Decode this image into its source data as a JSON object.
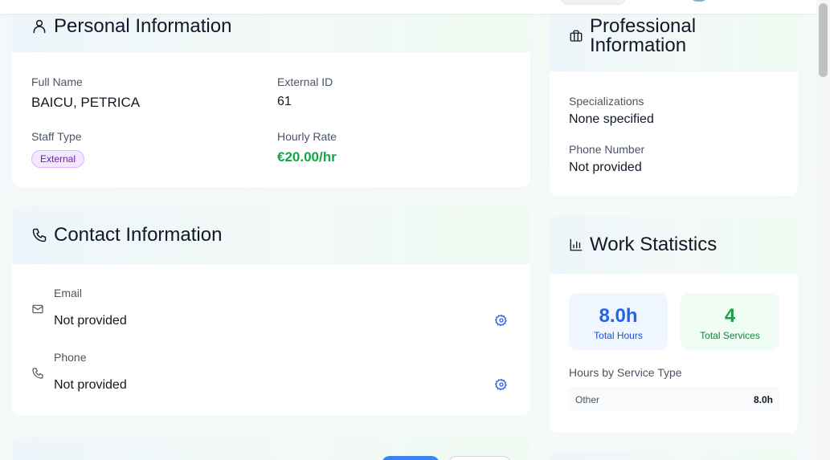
{
  "personal": {
    "title": "Personal Information",
    "full_name_label": "Full Name",
    "full_name": "BAICU, PETRICA",
    "external_id_label": "External ID",
    "external_id": "61",
    "staff_type_label": "Staff Type",
    "staff_type": "External",
    "hourly_rate_label": "Hourly Rate",
    "hourly_rate": "€20.00/hr"
  },
  "contact": {
    "title": "Contact Information",
    "email_label": "Email",
    "email_value": "Not provided",
    "phone_label": "Phone",
    "phone_value": "Not provided"
  },
  "professional": {
    "title_line1": "Professional",
    "title_line2": "Information",
    "specializations_label": "Specializations",
    "specializations_value": "None specified",
    "phone_label": "Phone Number",
    "phone_value": "Not provided"
  },
  "work_stats": {
    "title": "Work Statistics",
    "total_hours": "8.0h",
    "total_hours_label": "Total Hours",
    "total_services": "4",
    "total_services_label": "Total Services",
    "by_service_label": "Hours by Service Type",
    "service_rows": [
      {
        "name": "Other",
        "hours": "8.0h"
      }
    ]
  },
  "colors": {
    "accent_blue": "#2563eb",
    "accent_green": "#16a34a",
    "badge_purple": "#6b21a8"
  }
}
